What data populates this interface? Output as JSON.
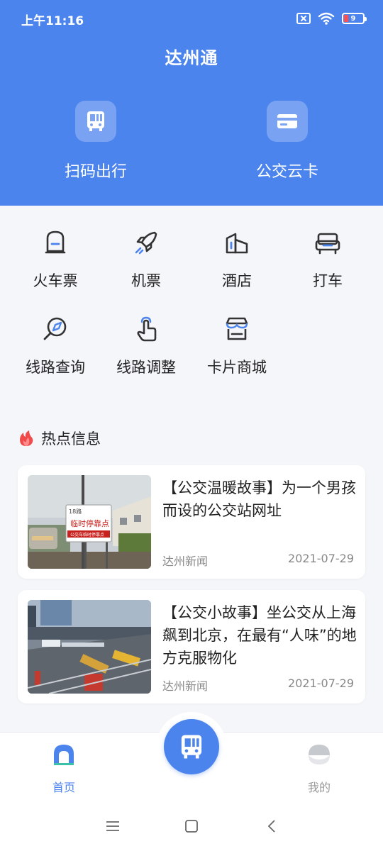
{
  "status_bar": {
    "time": "上午11:16",
    "battery": "9"
  },
  "header": {
    "title": "达州通"
  },
  "hero": [
    {
      "label": "扫码出行",
      "icon": "bus-icon"
    },
    {
      "label": "公交云卡",
      "icon": "card-icon"
    }
  ],
  "services": [
    {
      "label": "火车票",
      "icon": "train-icon"
    },
    {
      "label": "机票",
      "icon": "rocket-icon"
    },
    {
      "label": "酒店",
      "icon": "hotel-icon"
    },
    {
      "label": "打车",
      "icon": "car-icon"
    },
    {
      "label": "线路查询",
      "icon": "search-route-icon"
    },
    {
      "label": "线路调整",
      "icon": "tap-hand-icon"
    },
    {
      "label": "卡片商城",
      "icon": "shop-icon"
    }
  ],
  "hot": {
    "title": "热点信息",
    "news": [
      {
        "title": "【公交温暖故事】为一个男孩而设的公交站网址",
        "source": "达州新闻",
        "date": "2021-07-29",
        "sign_route": "18路",
        "sign_main": "临时停靠点",
        "sign_sub": "公交车临时停靠点"
      },
      {
        "title": "【公交小故事】坐公交从上海飙到北京，在最有“人味”的地方克服物化",
        "source": "达州新闻",
        "date": "2021-07-29"
      }
    ]
  },
  "tabbar": {
    "home": "首页",
    "me": "我的"
  },
  "colors": {
    "primary": "#4c84ee",
    "accent_red": "#f04a4a"
  }
}
